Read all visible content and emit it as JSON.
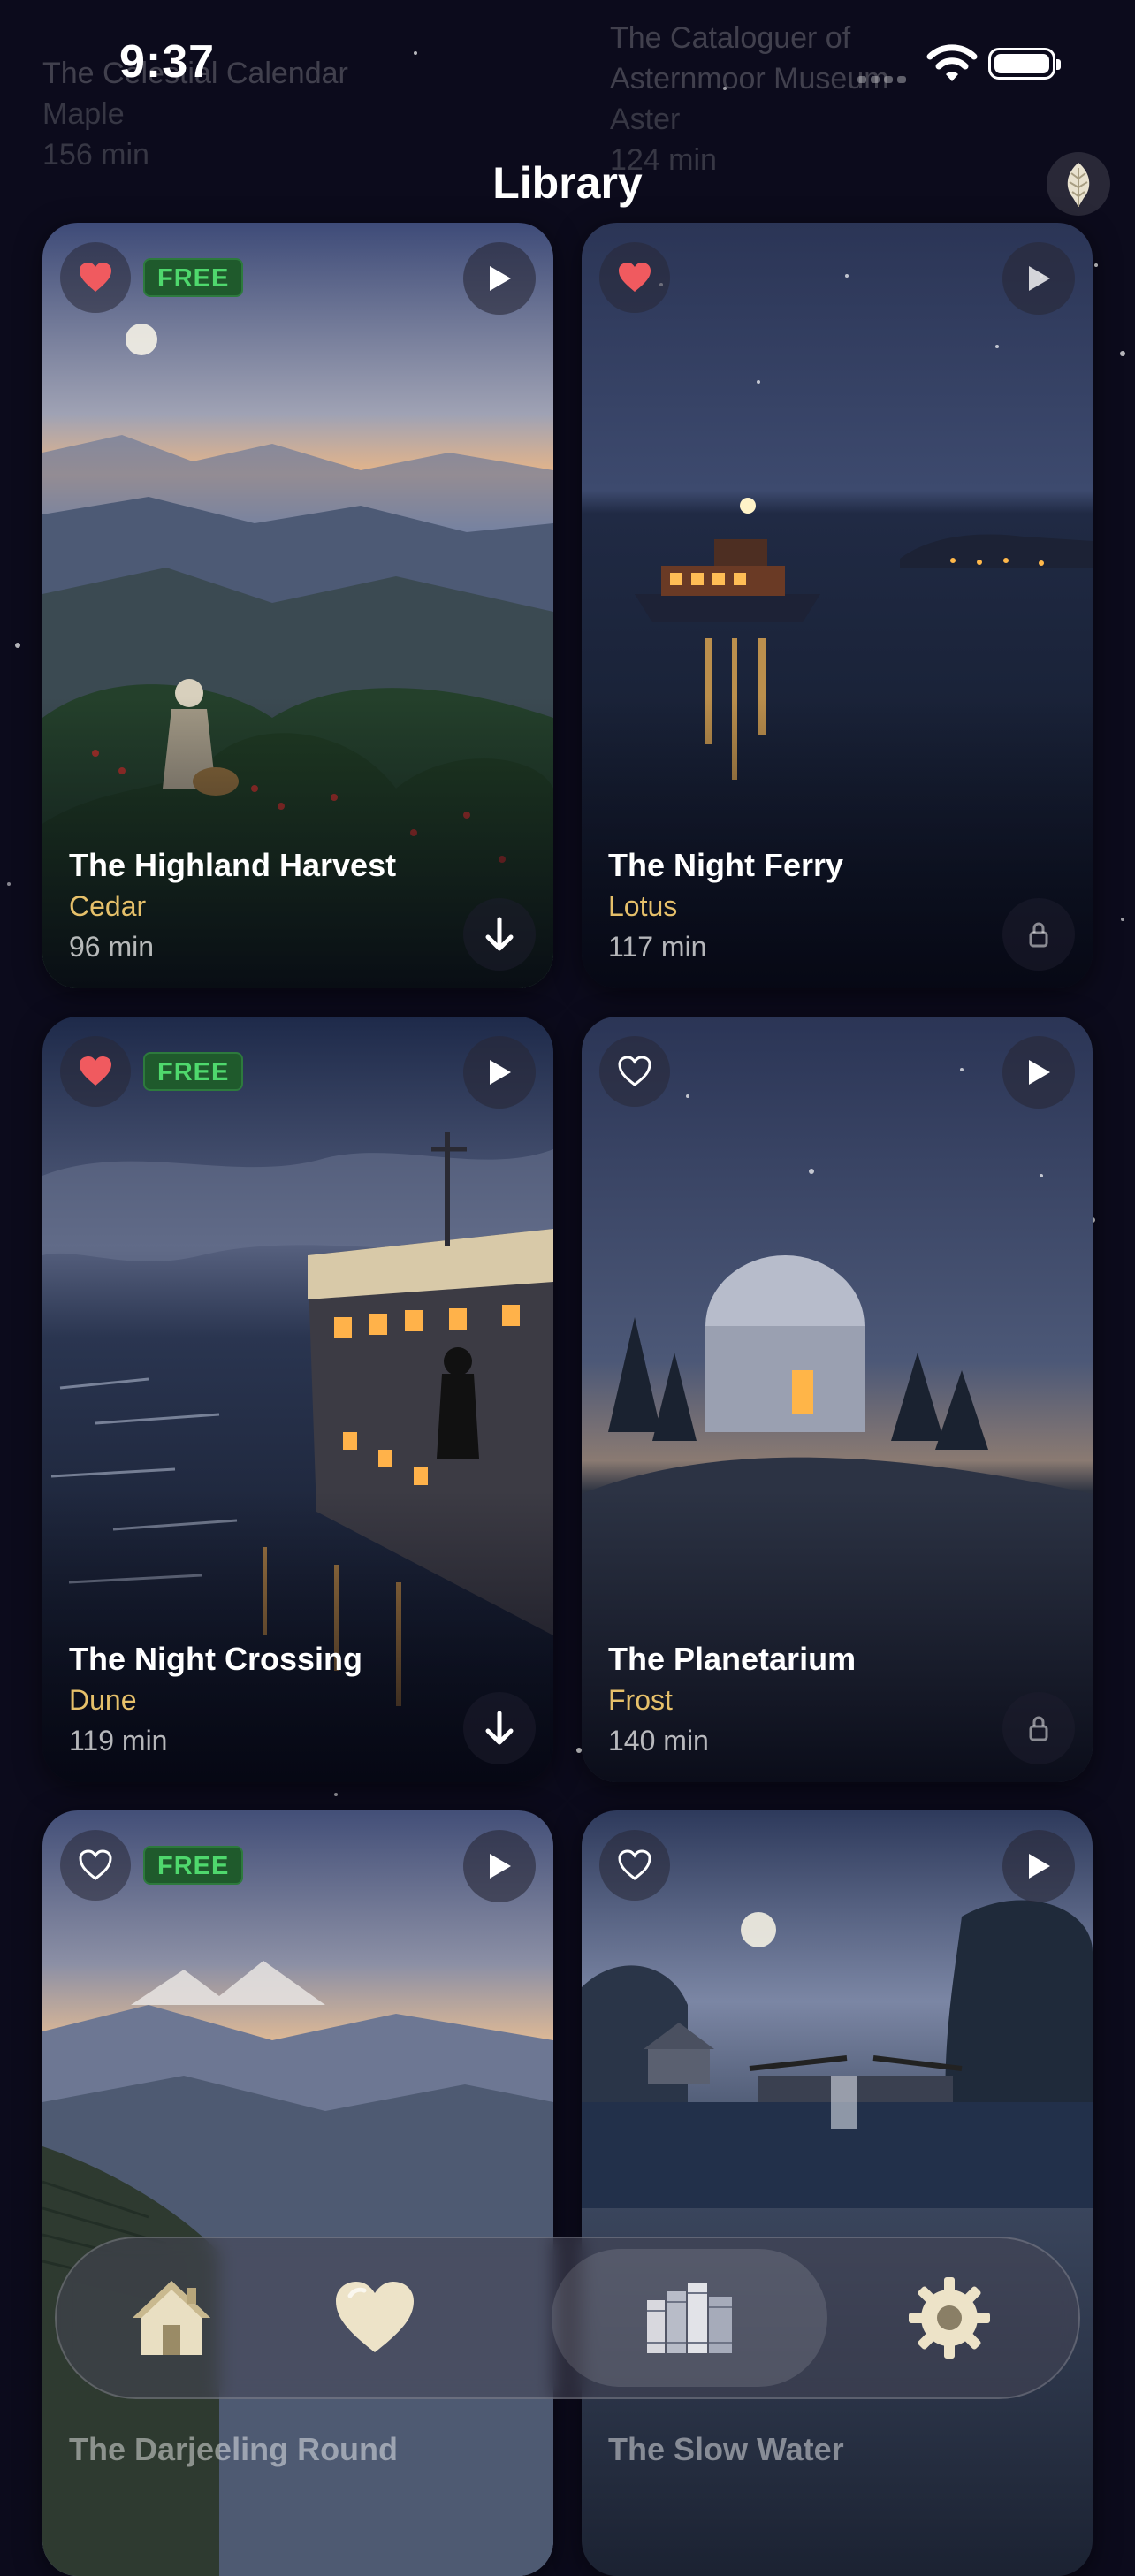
{
  "status_bar": {
    "time": "9:37"
  },
  "header": {
    "title": "Library",
    "background_ghost": [
      {
        "title": "The Celestial Calendar",
        "author": "Maple",
        "duration": "156 min"
      },
      {
        "title": "The Cataloguer of Asternmoor Museum",
        "author": "Aster",
        "duration": "124 min"
      }
    ]
  },
  "stories": [
    {
      "title": "The Highland Harvest",
      "author": "Cedar",
      "duration": "96 min",
      "favorite": true,
      "free": true,
      "free_label": "FREE",
      "action": "download"
    },
    {
      "title": "The Night Ferry",
      "author": "Lotus",
      "duration": "117 min",
      "favorite": true,
      "free": false,
      "action": "locked"
    },
    {
      "title": "The Night Crossing",
      "author": "Dune",
      "duration": "119 min",
      "favorite": true,
      "free": true,
      "free_label": "FREE",
      "action": "download"
    },
    {
      "title": "The Planetarium",
      "author": "Frost",
      "duration": "140 min",
      "favorite": false,
      "free": false,
      "action": "locked"
    },
    {
      "title": "The Darjeeling Round",
      "author": "",
      "duration": "",
      "favorite": false,
      "free": true,
      "free_label": "FREE",
      "action": ""
    },
    {
      "title": "The Slow Water",
      "author": "",
      "duration": "",
      "favorite": false,
      "free": false,
      "action": ""
    }
  ],
  "tab_bar": {
    "items": [
      {
        "name": "Home",
        "icon": "house-icon"
      },
      {
        "name": "Favorites",
        "icon": "heart-icon"
      },
      {
        "name": "Library",
        "icon": "books-icon",
        "active": true
      },
      {
        "name": "Settings",
        "icon": "gear-icon"
      }
    ]
  },
  "colors": {
    "background": "#0c0b1c",
    "author": "#e6c06a",
    "free_badge": "#4fd86d",
    "heart": "#f05a5f"
  }
}
